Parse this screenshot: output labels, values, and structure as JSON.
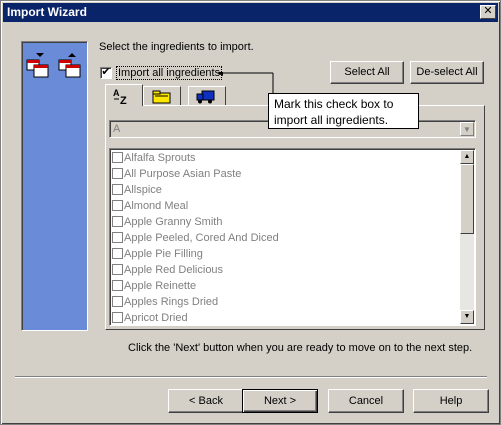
{
  "window": {
    "title": "Import Wizard",
    "close_glyph": "✕"
  },
  "instruction": "Select the ingredients to import.",
  "buttons": {
    "select_all": "Select All",
    "deselect_all": "De-select All",
    "back": "< Back",
    "next": "Next >",
    "cancel": "Cancel",
    "help": "Help"
  },
  "import_all": {
    "label": "Import all ingredients",
    "checked": true,
    "check_glyph": "✔"
  },
  "tabs": [
    {
      "label": "A-Z",
      "icon": "alphabetical-sort-icon"
    },
    {
      "label": "",
      "icon": "folder-icon"
    },
    {
      "label": "",
      "icon": "truck-icon"
    }
  ],
  "combo": {
    "value": "A",
    "arrow": "▼"
  },
  "ingredients": [
    "Alfalfa Sprouts",
    "All Purpose Asian Paste",
    "Allspice",
    "Almond Meal",
    "Apple Granny Smith",
    "Apple Peeled, Cored And Diced",
    "Apple Pie Filling",
    "Apple Red Delicious",
    "Apple Reinette",
    "Apples Rings Dried",
    "Apricot Dried"
  ],
  "scrollbar": {
    "up": "▲",
    "down": "▼"
  },
  "callout": "Mark this check box to import all ingredients.",
  "next_hint": "Click the 'Next' button when you are ready to move on to the next step.",
  "colors": {
    "title_bar": "#0a246a",
    "left_panel": "#6a8bd8",
    "face": "#d4d0c8"
  }
}
